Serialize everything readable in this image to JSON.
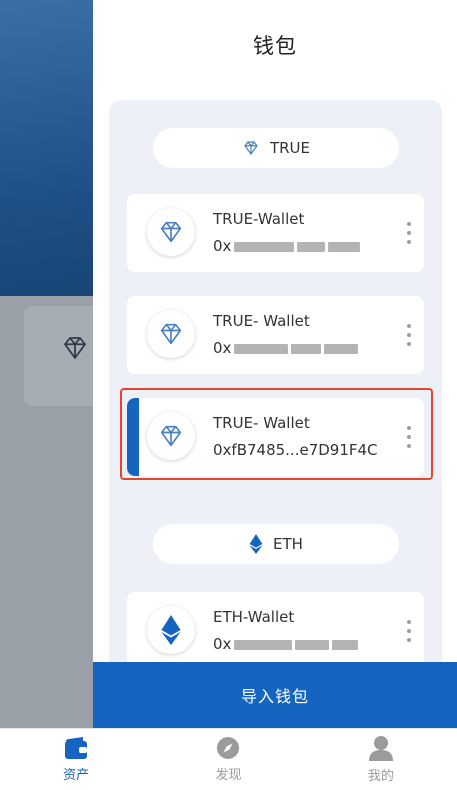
{
  "drawer": {
    "title": "钱包",
    "sections": [
      {
        "label": "TRUE",
        "wallets": [
          {
            "name": "TRUE-Wallet",
            "address_prefix": "0x",
            "address_obscured": true,
            "selected": false
          },
          {
            "name": "TRUE- Wallet",
            "address_prefix": "0x",
            "address_obscured": true,
            "selected": false
          },
          {
            "name": "TRUE- Wallet",
            "address": "0xfB7485...e7D91F4C",
            "selected": true
          }
        ]
      },
      {
        "label": "ETH",
        "wallets": [
          {
            "name": "ETH-Wallet",
            "address_prefix": "0x",
            "address_obscured": true,
            "selected": false
          }
        ]
      }
    ],
    "import_button": "导入钱包"
  },
  "tabbar": {
    "items": [
      {
        "label": "资产",
        "icon": "wallet-icon",
        "active": true
      },
      {
        "label": "发现",
        "icon": "compass-icon",
        "active": false
      },
      {
        "label": "我的",
        "icon": "user-icon",
        "active": false
      }
    ]
  },
  "colors": {
    "accent": "#1565c0",
    "panel_bg": "#eef0f8",
    "highlight": "#e5452f",
    "true_logo": "#4a7fc1",
    "eth_logo": "#1565c0"
  }
}
